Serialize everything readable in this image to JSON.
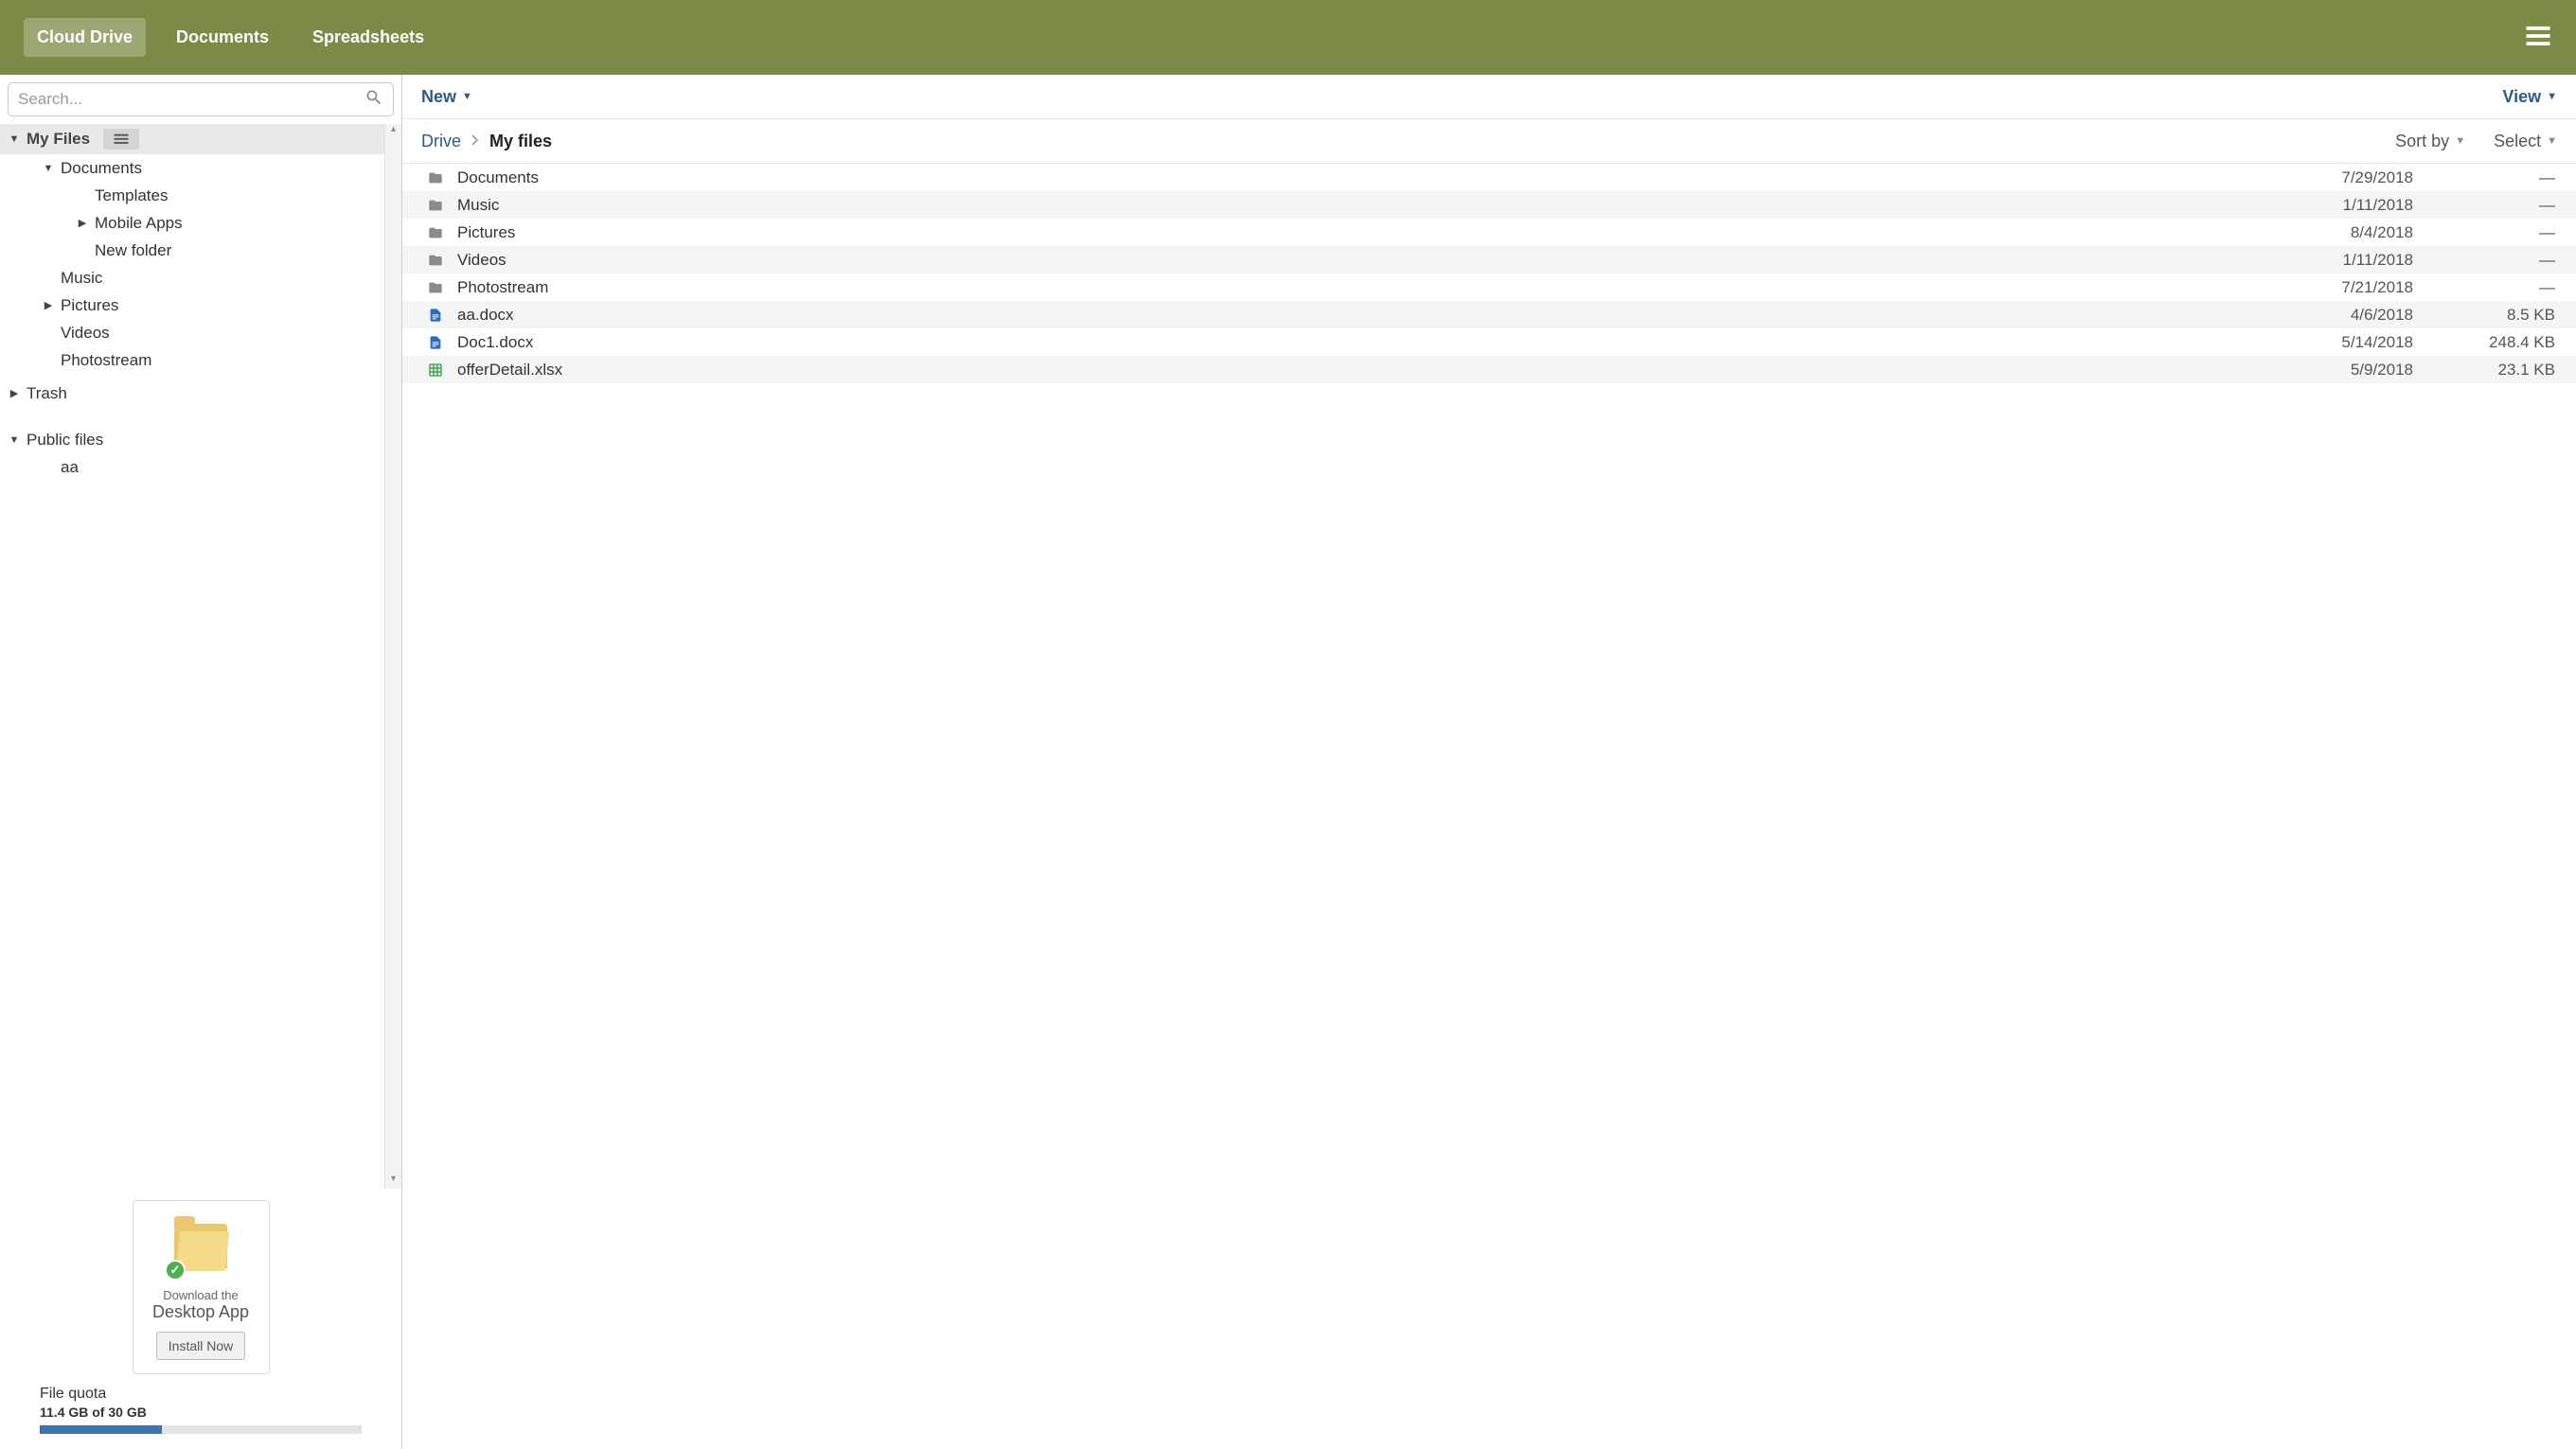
{
  "header": {
    "tabs": [
      {
        "label": "Cloud Drive",
        "active": true
      },
      {
        "label": "Documents",
        "active": false
      },
      {
        "label": "Spreadsheets",
        "active": false
      }
    ]
  },
  "sidebar": {
    "search_placeholder": "Search...",
    "tree": [
      {
        "label": "My Files",
        "type": "section",
        "indent": 0,
        "arrow": "down",
        "extra_icon": true
      },
      {
        "label": "Documents",
        "type": "folder",
        "indent": 1,
        "arrow": "down"
      },
      {
        "label": "Templates",
        "type": "folder",
        "indent": 2,
        "arrow": "none"
      },
      {
        "label": "Mobile Apps",
        "type": "folder",
        "indent": 2,
        "arrow": "right"
      },
      {
        "label": "New folder",
        "type": "folder",
        "indent": 2,
        "arrow": "none"
      },
      {
        "label": "Music",
        "type": "folder",
        "indent": 1,
        "arrow": "none"
      },
      {
        "label": "Pictures",
        "type": "folder",
        "indent": 1,
        "arrow": "right"
      },
      {
        "label": "Videos",
        "type": "folder",
        "indent": 1,
        "arrow": "none"
      },
      {
        "label": "Photostream",
        "type": "folder",
        "indent": 1,
        "arrow": "none"
      },
      {
        "label": "Trash",
        "type": "root",
        "indent": 0,
        "arrow": "right"
      },
      {
        "label": "Public files",
        "type": "root",
        "indent": 0,
        "arrow": "down"
      },
      {
        "label": "aa",
        "type": "folder",
        "indent": 1,
        "arrow": "none"
      }
    ],
    "promo": {
      "line1": "Download the",
      "line2": "Desktop App",
      "button": "Install Now"
    },
    "quota": {
      "label": "File quota",
      "value": "11.4 GB of 30 GB",
      "percent": 38
    }
  },
  "toolbar": {
    "new_label": "New",
    "view_label": "View"
  },
  "breadcrumb": {
    "root": "Drive",
    "current": "My files",
    "sort_label": "Sort by",
    "select_label": "Select"
  },
  "files": [
    {
      "name": "Documents",
      "date": "7/29/2018",
      "size": "—",
      "kind": "folder"
    },
    {
      "name": "Music",
      "date": "1/11/2018",
      "size": "—",
      "kind": "folder"
    },
    {
      "name": "Pictures",
      "date": "8/4/2018",
      "size": "—",
      "kind": "folder"
    },
    {
      "name": "Videos",
      "date": "1/11/2018",
      "size": "—",
      "kind": "folder"
    },
    {
      "name": "Photostream",
      "date": "7/21/2018",
      "size": "—",
      "kind": "folder"
    },
    {
      "name": "aa.docx",
      "date": "4/6/2018",
      "size": "8.5 KB",
      "kind": "doc"
    },
    {
      "name": "Doc1.docx",
      "date": "5/14/2018",
      "size": "248.4 KB",
      "kind": "doc"
    },
    {
      "name": "offerDetail.xlsx",
      "date": "5/9/2018",
      "size": "23.1 KB",
      "kind": "sheet"
    }
  ]
}
